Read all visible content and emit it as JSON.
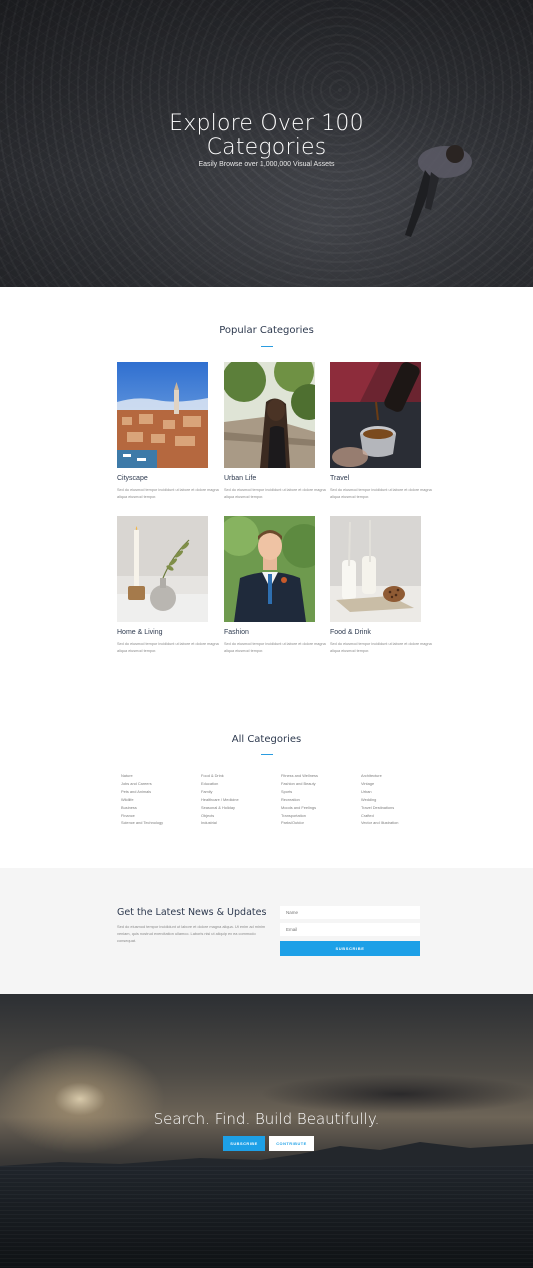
{
  "hero": {
    "title_line1": "Explore Over 100",
    "title_line2": "Categories",
    "subtitle": "Easily Browse over 1,000,000 Visual Assets"
  },
  "popular": {
    "title": "Popular Categories",
    "cards": [
      {
        "title": "Cityscape",
        "desc": "Sed do eiusmod tempor incididunt ut labore et dolore magna aliqua eiusmod tempor."
      },
      {
        "title": "Urban Life",
        "desc": "Sed do eiusmod tempor incididunt ut labore et dolore magna aliqua eiusmod tempor."
      },
      {
        "title": "Travel",
        "desc": "Sed do eiusmod tempor incididunt ut labore et dolore magna aliqua eiusmod tempor."
      },
      {
        "title": "Home & Living",
        "desc": "Sed do eiusmod tempor incididunt ut labore et dolore magna aliqua eiusmod tempor."
      },
      {
        "title": "Fashion",
        "desc": "Sed do eiusmod tempor incididunt ut labore et dolore magna aliqua eiusmod tempor."
      },
      {
        "title": "Food & Drink",
        "desc": "Sed do eiusmod tempor incididunt ut labore et dolore magna aliqua eiusmod tempor."
      }
    ]
  },
  "all_categories": {
    "title": "All Categories",
    "columns": [
      [
        "Nature",
        "Jobs and Careers",
        "Pets and Animals",
        "Wildlife",
        "Business",
        "Finance",
        "Science and Technology"
      ],
      [
        "Food & Drink",
        "Education",
        "Family",
        "Healthcare / Medicine",
        "Seasonal & Holiday",
        "Objects",
        "Industrial"
      ],
      [
        "Fitness and Wellness",
        "Fashion and Beauty",
        "Sports",
        "Recreation",
        "Moods and Feelings",
        "Transportation",
        "Parks/Outdor"
      ],
      [
        "Architecture",
        "Vintage",
        "Urban",
        "Wedding",
        "Travel Destinations",
        "Crafted",
        "Vector and Illustration"
      ]
    ]
  },
  "newsletter": {
    "title": "Get the Latest News & Updates",
    "text": "Sed do eiusmod tempor incididunt ut labore et dolore magna aliqua. Ut enim ad minim veniam, quis nostrud exercitation ullamco. Laboris nisi ut aliquip ex ea commodo consequat.",
    "name_placeholder": "Name",
    "email_placeholder": "Email",
    "button": "SUBSCRIBE"
  },
  "footer": {
    "title": "Search. Find. Build Beautifully.",
    "subscribe_button": "SUBSCRIBE",
    "contribute_button": "CONTRIBUTE"
  },
  "colors": {
    "accent": "#1da0e7",
    "heading": "#2e3a4f",
    "newsletter_bg": "#f5f5f5"
  }
}
